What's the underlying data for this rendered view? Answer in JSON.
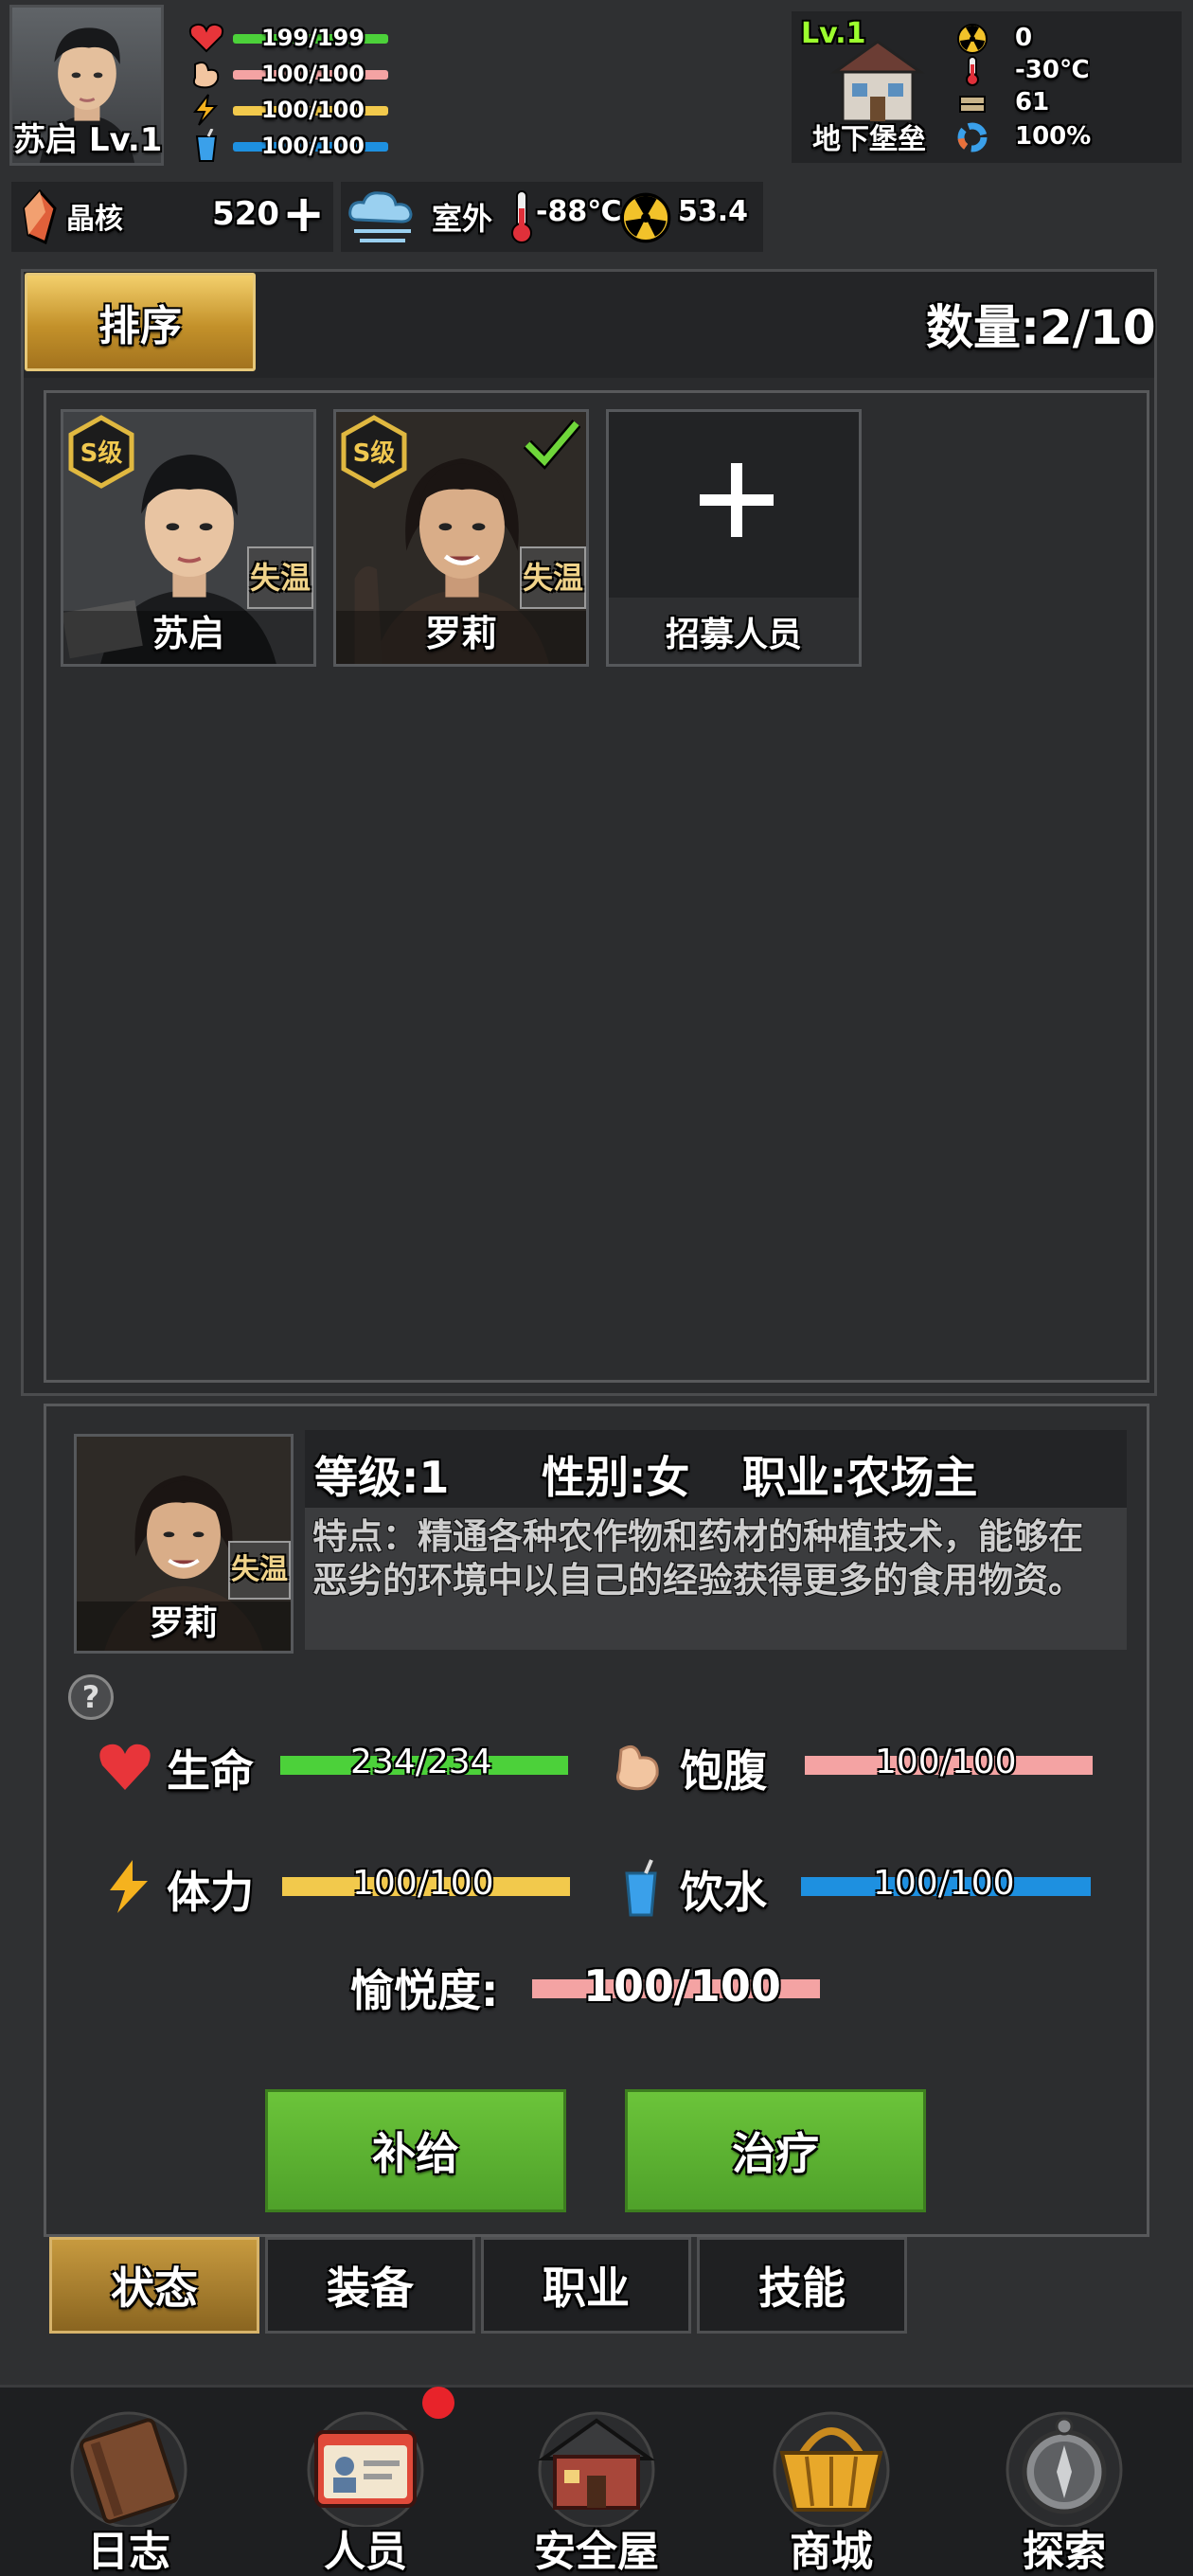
{
  "player": {
    "name_level": "苏启 Lv.1",
    "stats": [
      {
        "icon": "heart-icon",
        "value": "199/199",
        "color": "#4cd13a"
      },
      {
        "icon": "stomach-icon",
        "value": "100/100",
        "color": "#f4a3a3"
      },
      {
        "icon": "lightning-icon",
        "value": "100/100",
        "color": "#f2c94c"
      },
      {
        "icon": "water-cup-icon",
        "value": "100/100",
        "color": "#1e90e0"
      }
    ]
  },
  "shelter": {
    "level": "Lv.1",
    "name": "地下堡垒",
    "radiation": "0",
    "temperature": "-30℃",
    "supplies": "61",
    "durability": "100%"
  },
  "currency": {
    "label": "晶核",
    "value": "520",
    "add": "+"
  },
  "environment": {
    "label": "室外",
    "temperature": "-88℃",
    "radiation": "53.4"
  },
  "roster": {
    "sort_label": "排序",
    "count_label": "数量:2/10",
    "members": [
      {
        "name": "苏启",
        "rank": "S级",
        "trait": "失温",
        "selected": false
      },
      {
        "name": "罗莉",
        "rank": "S级",
        "trait": "失温",
        "selected": true
      }
    ],
    "recruit_label": "招募人员",
    "recruit_icon": "plus-icon"
  },
  "detail": {
    "name": "罗莉",
    "trait": "失温",
    "level": "等级:1",
    "gender": "性别:女",
    "job": "职业:农场主",
    "description": "特点：精通各种农作物和药材的种植技术，能够在恶劣的环境中以自己的经验获得更多的食用物资。",
    "help": "?",
    "stats": {
      "health": {
        "label": "生命",
        "value": "234/234",
        "color": "#4cd13a"
      },
      "satiety": {
        "label": "饱腹",
        "value": "100/100",
        "color": "#f4a3a3"
      },
      "stamina": {
        "label": "体力",
        "value": "100/100",
        "color": "#f2c94c"
      },
      "water": {
        "label": "饮水",
        "value": "100/100",
        "color": "#1e90e0"
      },
      "happiness": {
        "label": "愉悦度:",
        "value": "100/100",
        "color": "#f4a3a3"
      }
    },
    "supply_button": "补给",
    "heal_button": "治疗"
  },
  "tabs": [
    "状态",
    "装备",
    "职业",
    "技能"
  ],
  "nav": [
    {
      "label": "日志",
      "icon": "journal-icon"
    },
    {
      "label": "人员",
      "icon": "id-card-icon"
    },
    {
      "label": "安全屋",
      "icon": "house-icon"
    },
    {
      "label": "商城",
      "icon": "basket-icon"
    },
    {
      "label": "探索",
      "icon": "compass-icon"
    }
  ]
}
